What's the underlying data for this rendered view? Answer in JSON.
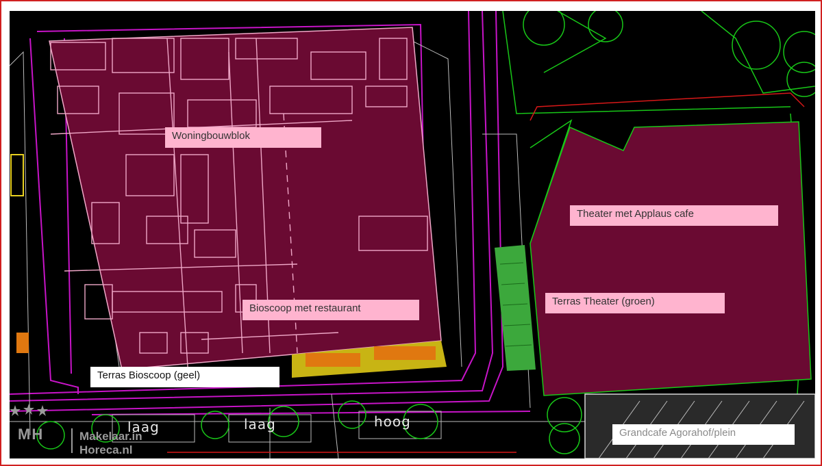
{
  "map": {
    "labels": {
      "woningbouwblok": "Woningbouwblok",
      "bioscoop": "Bioscoop met restaurant",
      "terras_bioscoop": "Terras Bioscoop (geel)",
      "theater": "Theater met Applaus cafe",
      "terras_theater": "Terras Theater (groen)",
      "grandcafe": "Grandcafe Agorahof/plein"
    },
    "road_labels": [
      "laag",
      "laag",
      "hoog"
    ],
    "colors": {
      "background": "#000000",
      "building": "#6a0a32",
      "building_lines": "#f0a8c8",
      "road_lines": "#d010d0",
      "green_lines": "#18d018",
      "terras_geel": "#c8b414",
      "terras_groen": "#3ca83c",
      "frame": "#d02020",
      "label_bg": "#ffb4cf"
    }
  },
  "logo": {
    "mark": "MH",
    "line1": "Makelaar.in",
    "line2": "Horeca.nl"
  }
}
